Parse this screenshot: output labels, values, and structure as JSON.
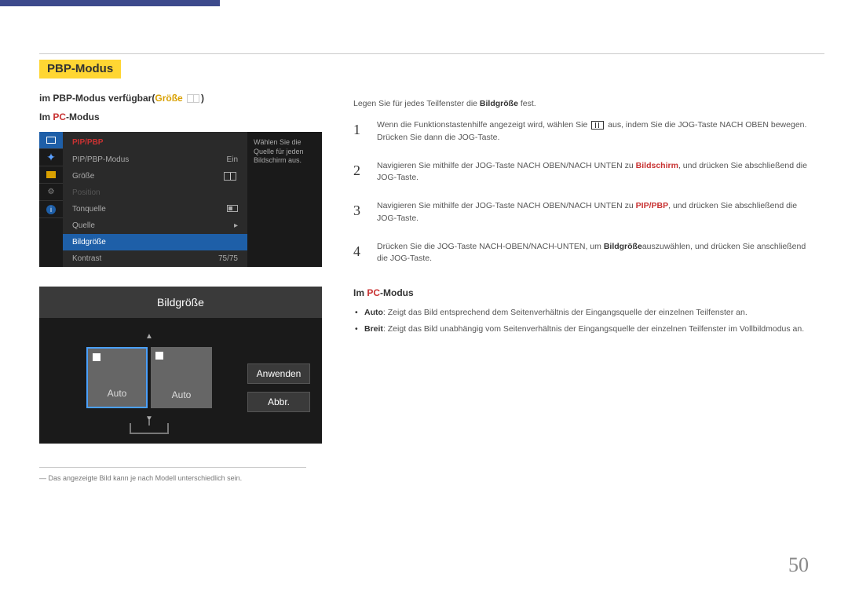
{
  "title": "PBP-Modus",
  "subtitle": {
    "pre": "im PBP-Modus verfügbar(",
    "kw": "Größe",
    "post": ")"
  },
  "modeHeader": {
    "pre": "Im ",
    "pc": "PC",
    "post": "-Modus"
  },
  "osd1": {
    "header": "PIP/PBP",
    "tip": "Wählen Sie die Quelle für jeden Bildschirm aus.",
    "rows": [
      {
        "l": "PIP/PBP-Modus",
        "r": "Ein"
      },
      {
        "l": "Größe",
        "r": ""
      },
      {
        "l": "Position",
        "r": ""
      },
      {
        "l": "Tonquelle",
        "r": ""
      },
      {
        "l": "Quelle",
        "r": "▸"
      },
      {
        "l": "Bildgröße",
        "r": ""
      },
      {
        "l": "Kontrast",
        "r": "75/75"
      }
    ]
  },
  "osd2": {
    "title": "Bildgröße",
    "leftLabel": "Auto",
    "rightLabel": "Auto",
    "apply": "Anwenden",
    "cancel": "Abbr."
  },
  "footnote": "Das angezeigte Bild kann je nach Modell unterschiedlich sein.",
  "pageNum": "50",
  "intro": {
    "pre": "Legen Sie für jedes Teilfenster die ",
    "kw": "Bildgröße",
    "post": " fest."
  },
  "steps": [
    {
      "n": "1",
      "parts": [
        "Wenn die Funktionstastenhilfe angezeigt wird, wählen Sie ",
        "ICON",
        " aus, indem Sie die JOG-Taste NACH OBEN bewegen. Drücken Sie dann die JOG-Taste."
      ]
    },
    {
      "n": "2",
      "pre": "Navigieren Sie mithilfe der JOG-Taste NACH OBEN/NACH UNTEN zu ",
      "kw": "Bildschirm",
      "post": ", und drücken Sie abschließend die JOG-Taste."
    },
    {
      "n": "3",
      "pre": "Navigieren Sie mithilfe der JOG-Taste NACH OBEN/NACH UNTEN zu ",
      "kw": "PIP/PBP",
      "post": ", und drücken Sie abschließend die JOG-Taste."
    },
    {
      "n": "4",
      "pre": "Drücken Sie die JOG-Taste NACH-OBEN/NACH-UNTEN, um ",
      "kw": "Bildgröße",
      "post": "auszuwählen, und drücken Sie anschließend die JOG-Taste."
    }
  ],
  "bullets": [
    {
      "kw": "Auto",
      "txt": ": Zeigt das Bild entsprechend dem Seitenverhältnis der Eingangsquelle der einzelnen Teilfenster an."
    },
    {
      "kw": "Breit",
      "txt": ": Zeigt das Bild unabhängig vom Seitenverhältnis der Eingangsquelle der einzelnen Teilfenster im Vollbildmodus an."
    }
  ]
}
